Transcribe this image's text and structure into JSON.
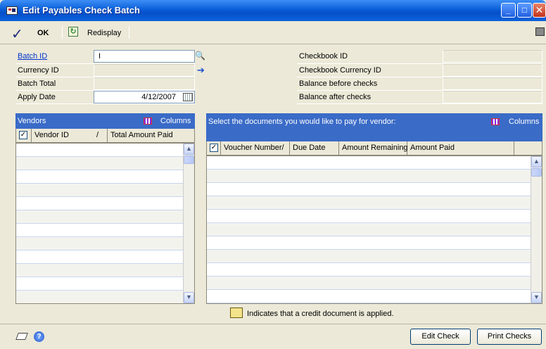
{
  "window": {
    "title": "Edit Payables Check Batch"
  },
  "toolbar": {
    "ok_label": "OK",
    "redisplay_label": "Redisplay"
  },
  "header_left": {
    "batch_id": {
      "label": "Batch ID",
      "value": "I"
    },
    "currency_id": {
      "label": "Currency ID",
      "value": ""
    },
    "batch_total": {
      "label": "Batch Total",
      "value": ""
    },
    "apply_date": {
      "label": "Apply Date",
      "value": "4/12/2007"
    }
  },
  "header_right": {
    "checkbook_id": {
      "label": "Checkbook ID",
      "value": ""
    },
    "checkbook_currency_id": {
      "label": "Checkbook Currency ID",
      "value": ""
    },
    "balance_before": {
      "label": "Balance before checks",
      "value": ""
    },
    "balance_after": {
      "label": "Balance after checks",
      "value": ""
    }
  },
  "vendors_panel": {
    "title": "Vendors",
    "columns_label": "Columns",
    "col_vendor_id": "Vendor ID",
    "sort_marker": "/",
    "col_total_amount_paid": "Total Amount Paid"
  },
  "documents_panel": {
    "title": "Select the documents you would like to pay for vendor:",
    "columns_label": "Columns",
    "col_voucher_number": "Voucher Number",
    "sort_marker": "/",
    "col_due_date": "Due Date",
    "col_amount_remaining": "Amount Remaining",
    "col_amount_paid": "Amount Paid"
  },
  "credit_note": "Indicates that a credit document is applied.",
  "buttons": {
    "edit_check": "Edit Check",
    "print_checks": "Print Checks"
  }
}
